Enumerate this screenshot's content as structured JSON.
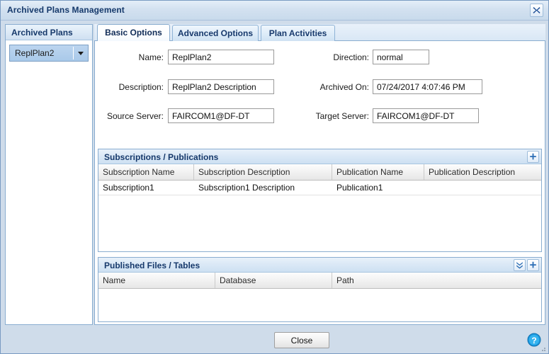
{
  "window": {
    "title": "Archived Plans Management",
    "close_icon": "close-x-icon"
  },
  "sidebar": {
    "header": "Archived Plans",
    "selected_plan": "ReplPlan2",
    "dropdown_icon": "chevron-down-icon"
  },
  "tabs": [
    {
      "label": "Basic Options",
      "active": true
    },
    {
      "label": "Advanced Options",
      "active": false
    },
    {
      "label": "Plan Activities",
      "active": false
    }
  ],
  "form": {
    "name_label": "Name:",
    "name_value": "ReplPlan2",
    "description_label": "Description:",
    "description_value": "ReplPlan2 Description",
    "source_server_label": "Source Server:",
    "source_server_value": "FAIRCOM1@DF-DT",
    "direction_label": "Direction:",
    "direction_value": "normal",
    "archived_on_label": "Archived On:",
    "archived_on_value": "07/24/2017 4:07:46 PM",
    "target_server_label": "Target Server:",
    "target_server_value": "FAIRCOM1@DF-DT"
  },
  "subscriptions_panel": {
    "title": "Subscriptions / Publications",
    "add_icon": "plus-icon",
    "columns": [
      "Subscription Name",
      "Subscription Description",
      "Publication Name",
      "Publication Description"
    ],
    "rows": [
      {
        "subscription_name": "Subscription1",
        "subscription_description": "Subscription1 Description",
        "publication_name": "Publication1",
        "publication_description": ""
      }
    ]
  },
  "published_files_panel": {
    "title": "Published Files / Tables",
    "expand_icon": "double-chevron-down-icon",
    "add_icon": "plus-icon",
    "columns": [
      "Name",
      "Database",
      "Path"
    ],
    "rows": []
  },
  "footer": {
    "close_label": "Close",
    "help_icon": "help-question-icon",
    "resize_grip_icon": "resize-grip-icon"
  },
  "colors": {
    "accent": "#16396b",
    "panel_border": "#8aadd0",
    "chrome": "#cfdcea",
    "help_blue": "#1c9ae0"
  }
}
